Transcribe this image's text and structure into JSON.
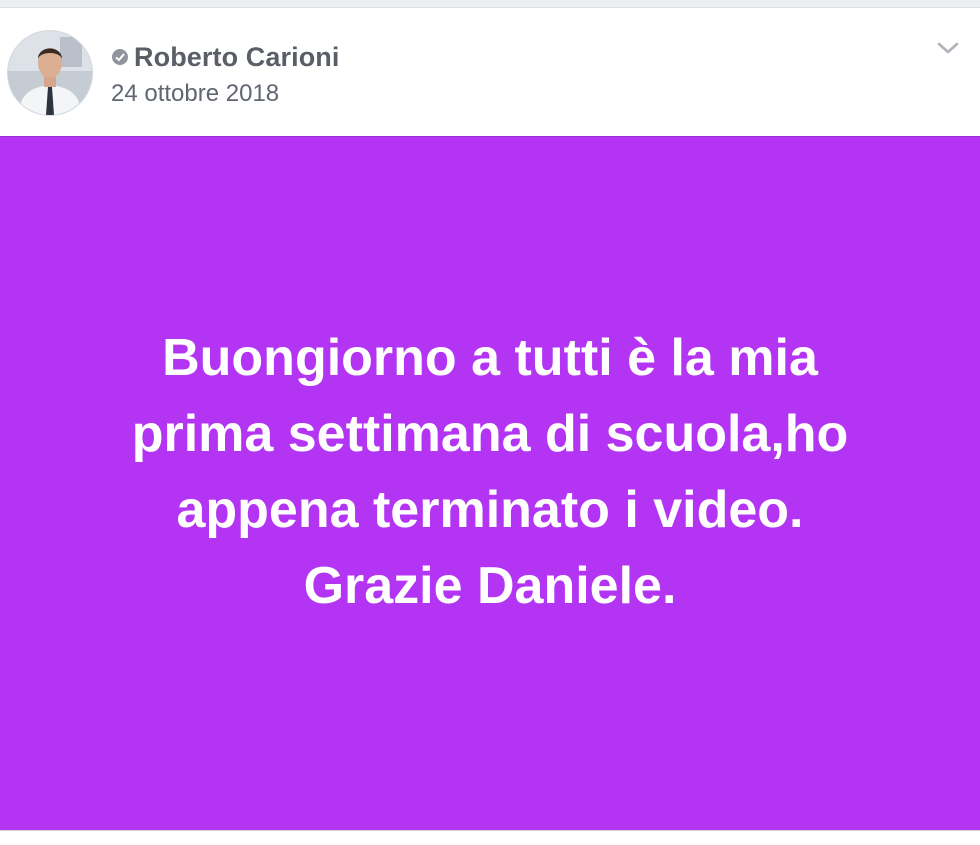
{
  "post": {
    "author": {
      "name": "Roberto Carioni",
      "avatar_icon": "user-photo-avatar",
      "badge_icon": "verified-check-icon"
    },
    "date": "24 ottobre 2018",
    "menu_icon": "chevron-down-icon",
    "text": "Buongiorno a tutti è la mia\nprima settimana di scuola,ho\nappena terminato i video.\nGrazie Daniele.",
    "background_color": "#b335f3",
    "text_color": "#ffffff"
  }
}
